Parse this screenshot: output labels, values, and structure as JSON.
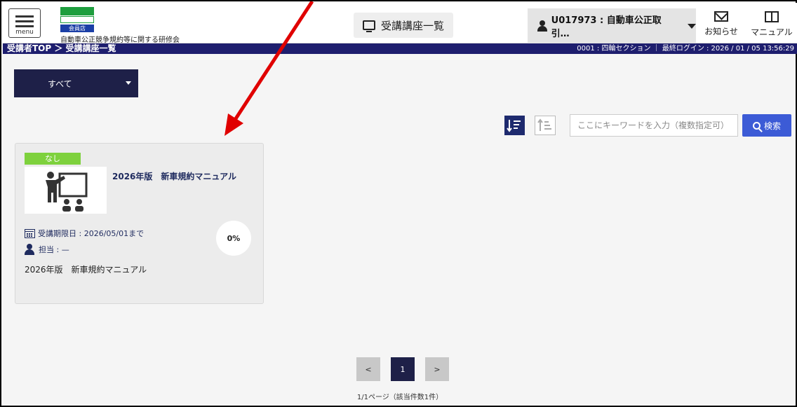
{
  "header": {
    "menu_label": "menu",
    "logo_sub": "会員店",
    "org_name": "自動車公正競争規約等に関する研修会",
    "course_list_label": "受講講座一覧",
    "user_label": "U017973 : 自動車公正取引…",
    "notice_label": "お知らせ",
    "manual_label": "マニュアル"
  },
  "navbar": {
    "breadcrumb": "受講者TOP ＞ 受講講座一覧",
    "right_text": "0001 : 四輪セクション ｜ 最終ログイン : 2026 / 01 / 05 13:56:29"
  },
  "filter": {
    "selected": "すべて"
  },
  "search": {
    "placeholder": "ここにキーワードを入力（複数指定可）",
    "button_label": "検索"
  },
  "course_card": {
    "badge": "なし",
    "title": "2026年版　新車規約マニュアル",
    "deadline": "受講期限日 : 2026/05/01まで",
    "tanto": "担当 : —",
    "description": "2026年版　新車規約マニュアル",
    "progress": "0%"
  },
  "pagination": {
    "prev": "<",
    "current": "1",
    "next": ">",
    "info": "1/1ページ（該当件数1件）"
  },
  "colors": {
    "navy": "#1e1e6e",
    "badge_green": "#7ed13d",
    "search_blue": "#3c5bd6",
    "annotation_arrow": "#e00000"
  }
}
